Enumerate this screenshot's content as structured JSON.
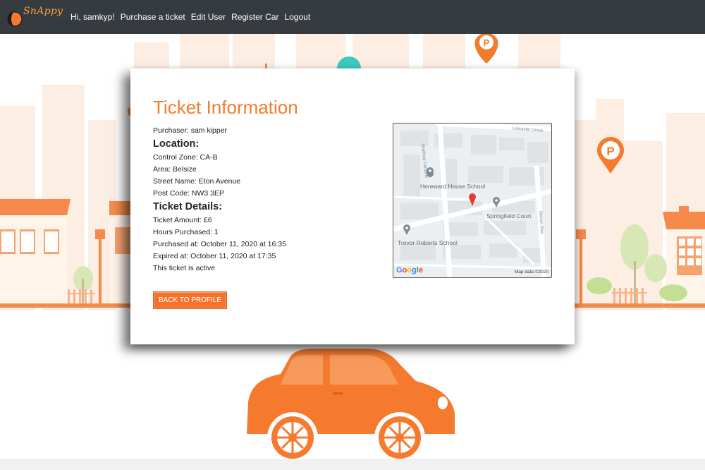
{
  "brand": {
    "name": "SnAppy"
  },
  "nav": {
    "greeting": "Hi, samkyp!",
    "purchase": "Purchase a ticket",
    "edit_user": "Edit User",
    "register_car": "Register Car",
    "logout": "Logout"
  },
  "ticket": {
    "title": "Ticket Information",
    "purchaser": "Purchaser: sam kipper",
    "location_heading": "Location:",
    "control_zone": "Control Zone: CA-B",
    "area": "Area: Belsize",
    "street": "Street Name: Eton Avenue",
    "post_code": "Post Code: NW3 3EP",
    "details_heading": "Ticket Details:",
    "amount": "Ticket Amount: £6",
    "hours": "Hours Purchased: 1",
    "purchased_at": "Purchased at: October 11, 2020 at 16:35",
    "expired_at": "Expired at: October 11, 2020 at 17:35",
    "status": "This ticket is active",
    "back_button": "BACK TO PROFILE"
  },
  "map": {
    "places": {
      "hereward": "Hereward House School",
      "springfield": "Springfield Court",
      "trevor": "Trevor Roberts School"
    },
    "streets": {
      "lancaster": "Lancaster Grove",
      "strathray": "Strathray Gardens",
      "merton": "Merton Rise"
    },
    "google": "Google",
    "attribution": "Map data ©2020"
  },
  "colors": {
    "accent": "#f47a2c",
    "navbar": "#363b40",
    "button": "#f57328",
    "map_pin": "#e53935"
  }
}
